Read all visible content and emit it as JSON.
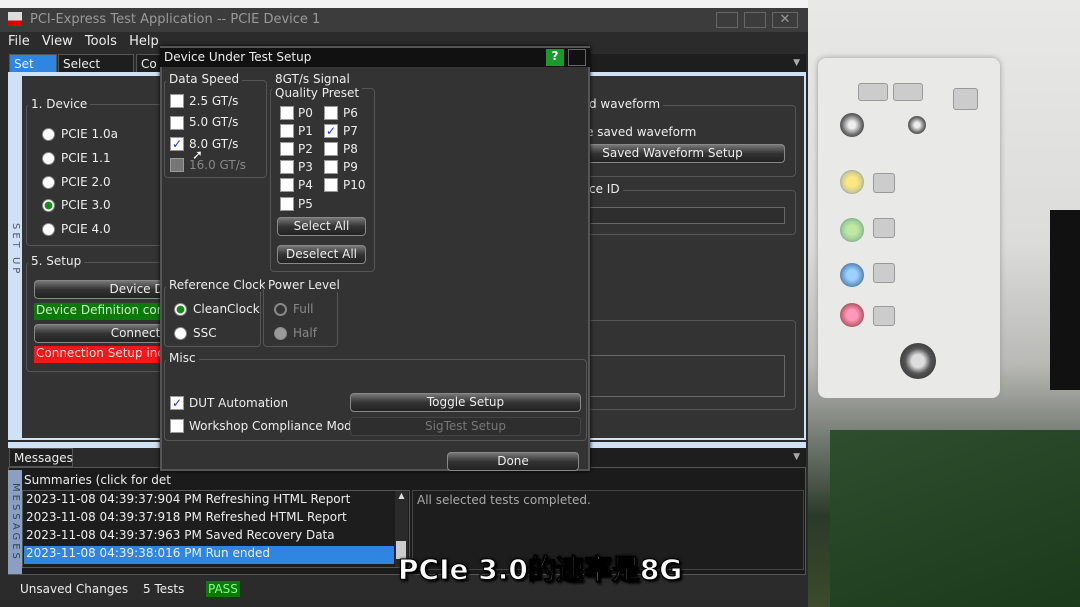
{
  "window": {
    "title": "PCI-Express Test Application -- PCIE Device 1"
  },
  "menu": [
    "File",
    "View",
    "Tools",
    "Help"
  ],
  "tabs": [
    "Set Up",
    "Select Tests",
    "Co"
  ],
  "side_label": "SET UP",
  "device_group": {
    "label": "1. Device",
    "options": [
      "PCIE 1.0a",
      "PCIE 1.1",
      "PCIE 2.0",
      "PCIE 3.0",
      "PCIE 4.0"
    ],
    "selected": "PCIE 3.0"
  },
  "setup_group": {
    "label": "5. Setup",
    "device_button": "Device De",
    "device_status": "Device Definition comp",
    "connection_button": "Connectio",
    "connection_status": "Connection Setup inco"
  },
  "waveform_group": {
    "label": "d waveform",
    "option": "e saved waveform",
    "button": "Saved Waveform Setup"
  },
  "id_group": {
    "label": "ce ID",
    "value": ""
  },
  "dialog": {
    "title": "Device Under Test Setup",
    "help": "?",
    "data_speed": {
      "label": "Data Speed",
      "options": [
        "2.5 GT/s",
        "5.0 GT/s",
        "8.0 GT/s",
        "16.0 GT/s"
      ],
      "checked": [
        "8.0 GT/s"
      ],
      "disabled": [
        "16.0 GT/s"
      ]
    },
    "presets": {
      "label_line1": "8GT/s Signal",
      "label_line2": "Quality Preset",
      "left": [
        "P0",
        "P1",
        "P2",
        "P3",
        "P4",
        "P5"
      ],
      "right": [
        "P6",
        "P7",
        "P8",
        "P9",
        "P10"
      ],
      "checked": [
        "P7"
      ],
      "select_all": "Select All",
      "deselect_all": "Deselect All"
    },
    "ref_clock": {
      "label": "Reference Clock",
      "options": [
        "CleanClock",
        "SSC"
      ],
      "selected": "CleanClock"
    },
    "power_level": {
      "label": "Power Level",
      "options": [
        "Full",
        "Half"
      ],
      "selected": "Half",
      "disabled": true
    },
    "misc": {
      "label": "Misc",
      "dut_automation": "DUT Automation",
      "dut_checked": true,
      "workshop": "Workshop Compliance Mode",
      "workshop_checked": false,
      "toggle_setup": "Toggle Setup",
      "sigtest_setup": "SigTest Setup"
    },
    "done": "Done"
  },
  "messages": {
    "tab": "Messages",
    "side_label": "MESSAGES",
    "summaries": "Summaries (click for det",
    "rows": [
      "2023-11-08 04:39:37:904 PM Refreshing HTML Report",
      "2023-11-08 04:39:37:918 PM Refreshed HTML Report",
      "2023-11-08 04:39:37:963 PM Saved Recovery Data",
      "2023-11-08 04:39:38:016 PM Run ended"
    ],
    "selected_index": 3,
    "detail": "All selected tests completed."
  },
  "status": {
    "changes": "Unsaved Changes",
    "tests": "5 Tests",
    "result": "PASS"
  },
  "subtitle": "PCIe 3.0的速率是8G",
  "colors": {
    "accent": "#2f86e0",
    "pass": "#0a7a0a",
    "fail": "#e01010",
    "ok_bar": "#0a7a0a"
  }
}
